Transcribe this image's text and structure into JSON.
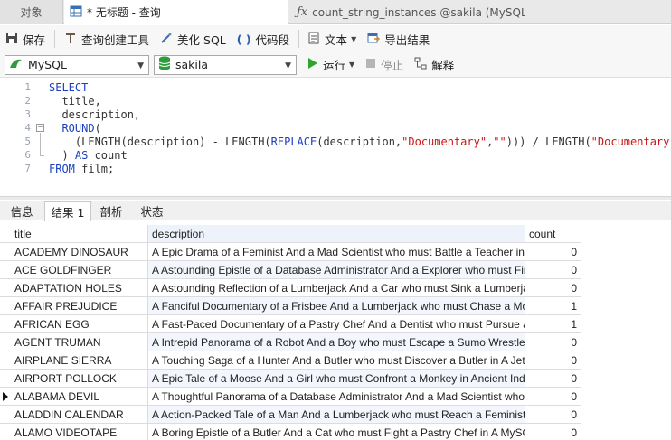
{
  "tabs": {
    "objects": "对象",
    "query": "* 无标题 - 查询",
    "function": "count_string_instances @sakila (MySQL)..."
  },
  "toolbar": {
    "save": "保存",
    "query_builder": "查询创建工具",
    "beautify": "美化 SQL",
    "snippet": "代码段",
    "text": "文本",
    "export": "导出结果"
  },
  "connection": {
    "type": "MySQL",
    "database": "sakila",
    "run": "运行",
    "stop": "停止",
    "explain": "解释"
  },
  "editor": {
    "line_numbers": [
      "1",
      "2",
      "3",
      "4",
      "5",
      "6",
      "7"
    ]
  },
  "result_tabs": [
    "信息",
    "结果 1",
    "剖析",
    "状态"
  ],
  "results": {
    "columns": [
      "title",
      "description",
      "count"
    ],
    "rows": [
      [
        "ACADEMY DINOSAUR",
        "A Epic Drama of a Feminist And a Mad Scientist who must Battle a Teacher in The Canadian Rockies",
        "0"
      ],
      [
        "ACE GOLDFINGER",
        "A Astounding Epistle of a Database Administrator And a Explorer who must Find a Car in Ancient China",
        "0"
      ],
      [
        "ADAPTATION HOLES",
        "A Astounding Reflection of a Lumberjack And a Car who must Sink a Lumberjack in A Baloon Factory",
        "0"
      ],
      [
        "AFFAIR PREJUDICE",
        "A Fanciful Documentary of a Frisbee And a Lumberjack who must Chase a Monkey in A Shark Tank",
        "1"
      ],
      [
        "AFRICAN EGG",
        "A Fast-Paced Documentary of a Pastry Chef And a Dentist who must Pursue a Forensic Psychologist",
        "1"
      ],
      [
        "AGENT TRUMAN",
        "A Intrepid Panorama of a Robot And a Boy who must Escape a Sumo Wrestler in Ancient China",
        "0"
      ],
      [
        "AIRPLANE SIERRA",
        "A Touching Saga of a Hunter And a Butler who must Discover a Butler in A Jet Boat",
        "0"
      ],
      [
        "AIRPORT POLLOCK",
        "A Epic Tale of a Moose And a Girl who must Confront a Monkey in Ancient India",
        "0"
      ],
      [
        "ALABAMA DEVIL",
        "A Thoughtful Panorama of a Database Administrator And a Mad Scientist who must Outgun a Mad Scientist",
        "0"
      ],
      [
        "ALADDIN CALENDAR",
        "A Action-Packed Tale of a Man And a Lumberjack who must Reach a Feminist in Ancient China",
        "0"
      ],
      [
        "ALAMO VIDEOTAPE",
        "A Boring Epistle of a Butler And a Cat who must Fight a Pastry Chef in A MySQL Convention",
        "0"
      ]
    ]
  },
  "colors": {
    "keyword": "#1a3fc2",
    "string": "#c41a16",
    "run_icon": "#2fa52f",
    "db_icon": "#2e9b3e"
  }
}
